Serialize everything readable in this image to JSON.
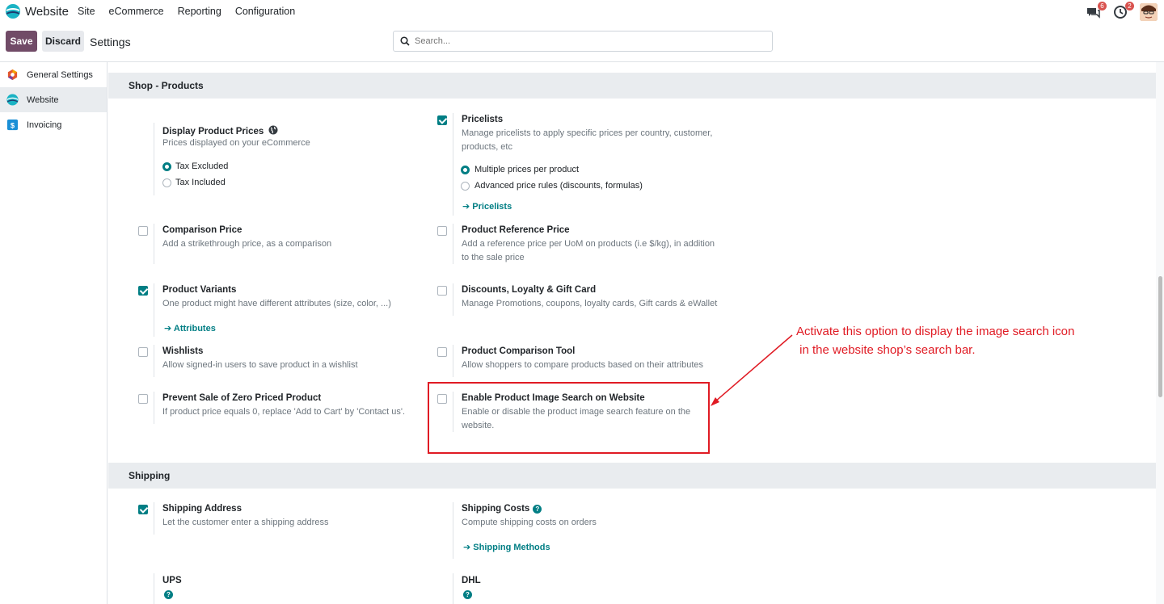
{
  "navbar": {
    "app_name": "Website",
    "menu": [
      "Site",
      "eCommerce",
      "Reporting",
      "Configuration"
    ],
    "messages_badge": "6",
    "activities_badge": "2"
  },
  "control_panel": {
    "save_label": "Save",
    "discard_label": "Discard",
    "title": "Settings",
    "search_placeholder": "Search..."
  },
  "sidebar": {
    "items": [
      {
        "label": "General Settings",
        "icon": "general-settings-icon",
        "active": false
      },
      {
        "label": "Website",
        "icon": "website-icon",
        "active": true
      },
      {
        "label": "Invoicing",
        "icon": "invoicing-icon",
        "active": false
      }
    ]
  },
  "shop_products": {
    "header": "Shop - Products",
    "display_prices": {
      "title": "Display Product Prices",
      "desc": "Prices displayed on your eCommerce",
      "options": [
        "Tax Excluded",
        "Tax Included"
      ],
      "selected": "Tax Excluded"
    },
    "pricelists": {
      "title": "Pricelists",
      "desc_line1": "Manage pricelists to apply specific prices per country, customer,",
      "desc_line2": "products, etc",
      "options": [
        "Multiple prices per product",
        "Advanced price rules (discounts, formulas)"
      ],
      "selected": "Multiple prices per product",
      "link": "Pricelists",
      "checked": true
    },
    "comparison_price": {
      "title": "Comparison Price",
      "desc": "Add a strikethrough price, as a comparison",
      "checked": false
    },
    "reference_price": {
      "title": "Product Reference Price",
      "desc_line1": "Add a reference price per UoM on products (i.e $/kg), in addition",
      "desc_line2": "to the sale price",
      "checked": false
    },
    "variants": {
      "title": "Product Variants",
      "desc": "One product might have different attributes (size, color, ...)",
      "link": "Attributes",
      "checked": true
    },
    "discounts": {
      "title": "Discounts, Loyalty & Gift Card",
      "desc": "Manage Promotions, coupons, loyalty cards, Gift cards & eWallet",
      "checked": false
    },
    "wishlists": {
      "title": "Wishlists",
      "desc": "Allow signed-in users to save product in a wishlist",
      "checked": false
    },
    "comparison_tool": {
      "title": "Product Comparison Tool",
      "desc": "Allow shoppers to compare products based on their attributes",
      "checked": false
    },
    "zero_price": {
      "title": "Prevent Sale of Zero Priced Product",
      "desc": "If product price equals 0, replace 'Add to Cart' by 'Contact us'.",
      "checked": false
    },
    "image_search": {
      "title": "Enable Product Image Search on Website",
      "desc_line1": "Enable or disable the product image search feature on the",
      "desc_line2": "website.",
      "checked": false
    }
  },
  "shipping": {
    "header": "Shipping",
    "address": {
      "title": "Shipping Address",
      "desc": "Let the customer enter a shipping address",
      "checked": true
    },
    "costs": {
      "title": "Shipping Costs",
      "desc": "Compute shipping costs on orders",
      "link": "Shipping Methods"
    },
    "ups": {
      "title": "UPS"
    },
    "dhl": {
      "title": "DHL"
    }
  },
  "annotation": {
    "line1": "Activate this option to display the image search icon",
    "line2": " in the website shop’s search bar.",
    "color": "#e01b24"
  },
  "colors": {
    "primary": "#714b67",
    "accent": "#017e84"
  }
}
